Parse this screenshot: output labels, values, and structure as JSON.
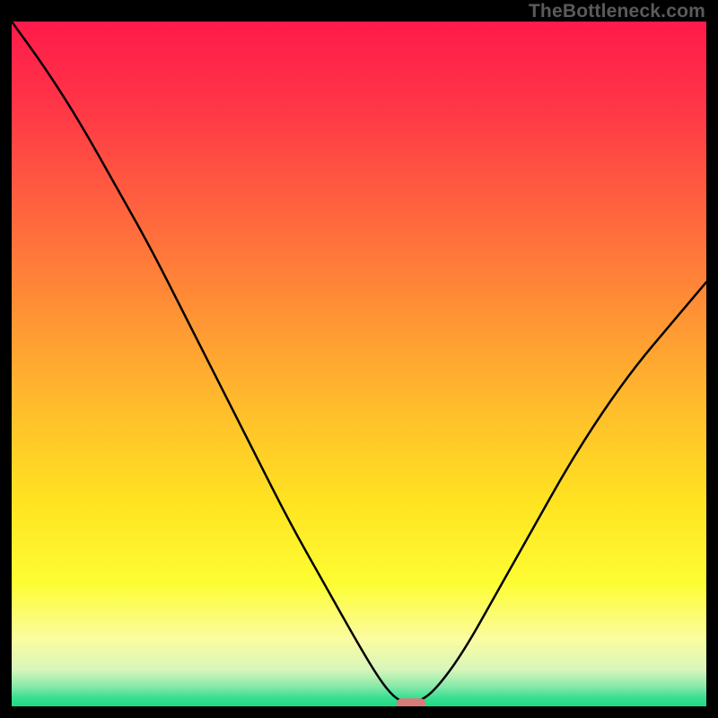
{
  "watermark": "TheBottleneck.com",
  "chart_data": {
    "type": "line",
    "title": "",
    "xlabel": "",
    "ylabel": "",
    "xlim": [
      0,
      100
    ],
    "ylim": [
      0,
      100
    ],
    "grid": false,
    "legend": false,
    "background_gradient": {
      "type": "vertical",
      "stops": [
        {
          "offset": 0.0,
          "color": "#ff1a4b"
        },
        {
          "offset": 0.12,
          "color": "#ff3547"
        },
        {
          "offset": 0.25,
          "color": "#ff5c40"
        },
        {
          "offset": 0.4,
          "color": "#ff8a36"
        },
        {
          "offset": 0.55,
          "color": "#ffb92d"
        },
        {
          "offset": 0.7,
          "color": "#ffe321"
        },
        {
          "offset": 0.82,
          "color": "#fdfd33"
        },
        {
          "offset": 0.9,
          "color": "#fbfca0"
        },
        {
          "offset": 0.945,
          "color": "#d9f6bb"
        },
        {
          "offset": 0.97,
          "color": "#86e9a9"
        },
        {
          "offset": 0.985,
          "color": "#3ddf93"
        },
        {
          "offset": 1.0,
          "color": "#17d983"
        }
      ]
    },
    "series": [
      {
        "name": "bottleneck-curve",
        "stroke": "#000000",
        "stroke_width": 2.5,
        "x": [
          0,
          5,
          10,
          15,
          20,
          25,
          30,
          35,
          40,
          45,
          50,
          53,
          55,
          56.5,
          58.5,
          61,
          65,
          70,
          75,
          80,
          85,
          90,
          95,
          100
        ],
        "y": [
          100,
          93,
          85,
          76,
          67,
          57,
          47,
          37,
          27,
          18,
          9,
          4,
          1.5,
          0.7,
          0.7,
          2.5,
          8,
          17,
          26,
          35,
          43,
          50,
          56,
          62
        ]
      }
    ],
    "marker": {
      "name": "optimal-marker",
      "shape": "rounded-rect",
      "x": 57.5,
      "y": 0.5,
      "width_units": 4.2,
      "height_units": 1.6,
      "color": "#d77a7a"
    }
  }
}
